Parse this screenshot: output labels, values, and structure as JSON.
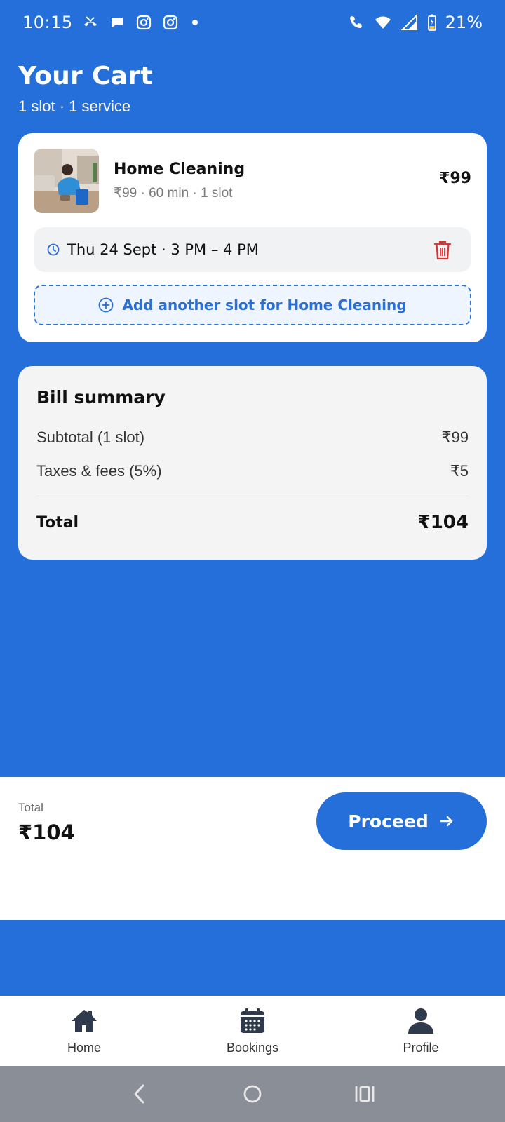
{
  "status_bar": {
    "time": "10:15",
    "battery": "21%"
  },
  "header": {
    "title": "Your Cart",
    "subtitle": "1 slot · 1 service"
  },
  "cart_item": {
    "name": "Home Cleaning",
    "meta": "₹99 · 60 min · 1 slot",
    "price": "₹99",
    "slot_text": "Thu 24 Sept · 3 PM – 4 PM",
    "add_slot_label": "Add another slot for Home Cleaning"
  },
  "bill_summary": {
    "title": "Bill summary",
    "lines": [
      {
        "label": "Subtotal (1 slot)",
        "value": "₹99"
      },
      {
        "label": "Taxes & fees (5%)",
        "value": "₹5"
      }
    ],
    "total_label": "Total",
    "total_value": "₹104"
  },
  "checkout": {
    "label": "Total",
    "amount": "₹104",
    "button_label": "Proceed"
  },
  "bottom_nav": {
    "items": [
      {
        "label": "Home",
        "icon": "home-icon"
      },
      {
        "label": "Bookings",
        "icon": "calendar-icon"
      },
      {
        "label": "Profile",
        "icon": "person-icon"
      }
    ]
  },
  "colors": {
    "primary": "#246fd9",
    "danger": "#e03131",
    "card_bg": "#ffffff",
    "bill_bg": "#f4f4f4"
  }
}
